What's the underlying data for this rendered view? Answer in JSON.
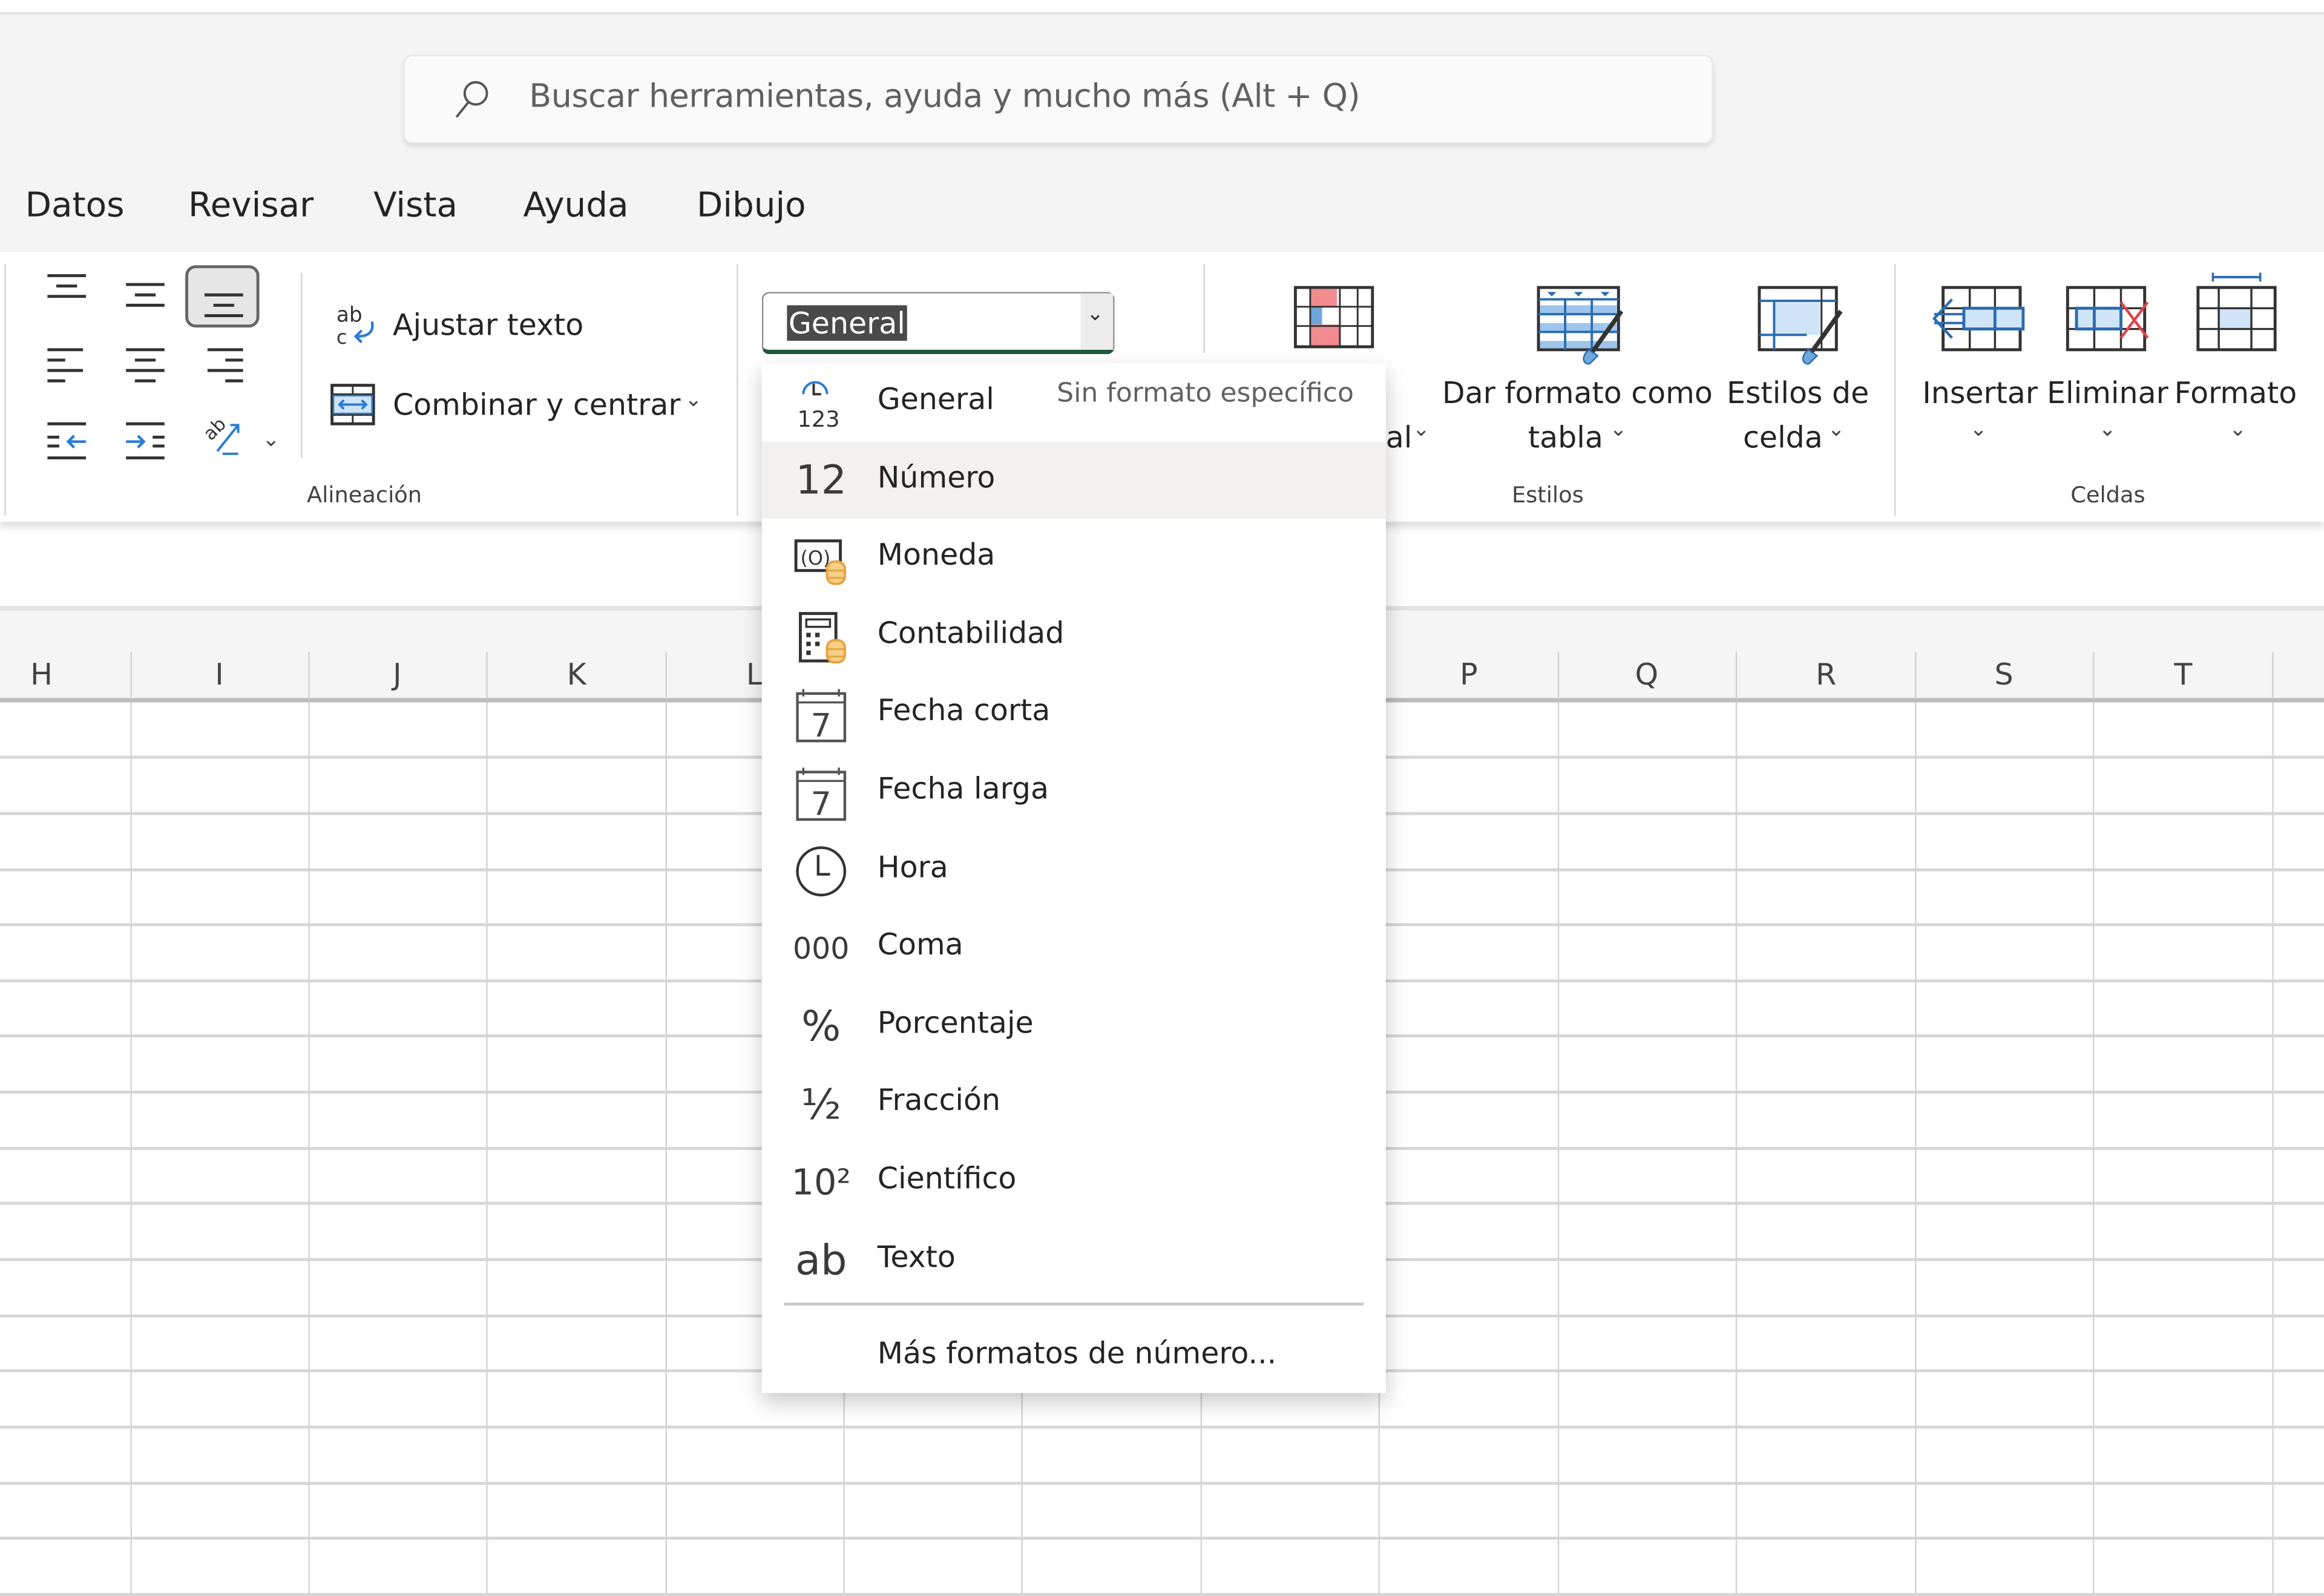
{
  "search": {
    "placeholder": "Buscar herramientas, ayuda y mucho más (Alt + Q)"
  },
  "tabs": [
    "Datos",
    "Revisar",
    "Vista",
    "Ayuda",
    "Dibujo"
  ],
  "ribbon": {
    "alignment": {
      "group_label": "Alineación",
      "wrap_text": "Ajustar texto",
      "merge_center": "Combinar y centrar"
    },
    "number": {
      "format_value": "General"
    },
    "styles": {
      "group_label": "Estilos",
      "conditional_partial": "al",
      "format_as_table_line1": "Dar formato como",
      "format_as_table_line2": "tabla",
      "cell_styles_line1": "Estilos de",
      "cell_styles_line2": "celda"
    },
    "cells": {
      "group_label": "Celdas",
      "insert": "Insertar",
      "delete": "Eliminar",
      "format": "Formato"
    }
  },
  "columns": [
    "H",
    "I",
    "J",
    "K",
    "L",
    "P",
    "Q",
    "R",
    "S",
    "T"
  ],
  "number_format_menu": {
    "items": [
      {
        "label": "General",
        "description": "Sin formato específico",
        "icon": "general-123-icon"
      },
      {
        "label": "Número",
        "icon_text": "12",
        "icon": "number-icon",
        "hovered": true
      },
      {
        "label": "Moneda",
        "icon": "currency-icon"
      },
      {
        "label": "Contabilidad",
        "icon": "accounting-icon"
      },
      {
        "label": "Fecha corta",
        "icon_text": "7",
        "icon": "calendar-icon"
      },
      {
        "label": "Fecha larga",
        "icon_text": "7",
        "icon": "calendar-icon"
      },
      {
        "label": "Hora",
        "icon": "clock-icon"
      },
      {
        "label": "Coma",
        "icon_text": "000",
        "icon": "comma-icon"
      },
      {
        "label": "Porcentaje",
        "icon_text": "%",
        "icon": "percent-icon"
      },
      {
        "label": "Fracción",
        "icon_text": "½",
        "icon": "fraction-icon"
      },
      {
        "label": "Científico",
        "icon_text": "10²",
        "icon": "scientific-icon"
      },
      {
        "label": "Texto",
        "icon_text": "ab",
        "icon": "text-icon"
      }
    ],
    "more_formats": "Más formatos de número...",
    "partial_chevron": "›"
  },
  "colors": {
    "accent_green": "#1e5a3a",
    "accent_blue": "#2b7cd3",
    "conditional_red": "#f28b8f",
    "coin_orange": "#e8a33d",
    "delete_red": "#e0424a"
  }
}
